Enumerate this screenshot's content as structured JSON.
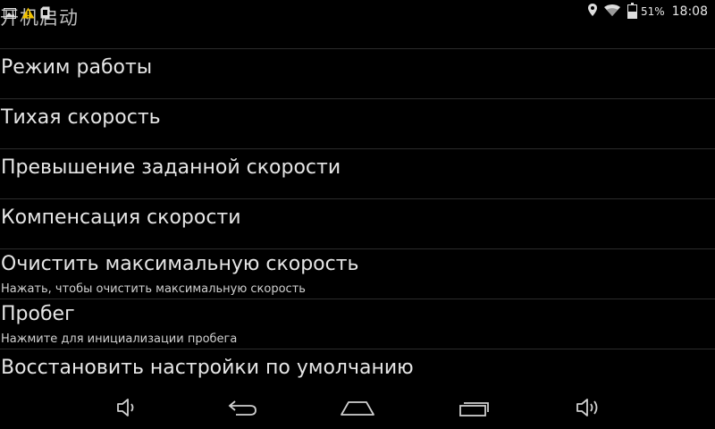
{
  "status_bar": {
    "app_title": "开机启动",
    "battery_text": "51%",
    "battery_level": 0.51,
    "time": "18:08",
    "left_icons": [
      "image-icon",
      "warning-icon",
      "sd-card-icon"
    ],
    "right_icons": [
      "location-icon",
      "wifi-icon",
      "battery-icon"
    ]
  },
  "settings": {
    "items": [
      {
        "title": "Режим работы",
        "subtitle": ""
      },
      {
        "title": "Тихая скорость",
        "subtitle": ""
      },
      {
        "title": "Превышение заданной скорости",
        "subtitle": ""
      },
      {
        "title": "Компенсация скорости",
        "subtitle": ""
      },
      {
        "title": "Очистить максимальную скорость",
        "subtitle": "Нажать, чтобы очистить максимальную скорость"
      },
      {
        "title": "Пробег",
        "subtitle": "Нажмите для инициализации пробега"
      },
      {
        "title": "Восстановить настройки по умолчанию",
        "subtitle": ""
      }
    ]
  },
  "nav_bar": {
    "buttons": [
      "volume-down-icon",
      "back-icon",
      "home-icon",
      "recent-apps-icon",
      "volume-up-icon"
    ]
  }
}
